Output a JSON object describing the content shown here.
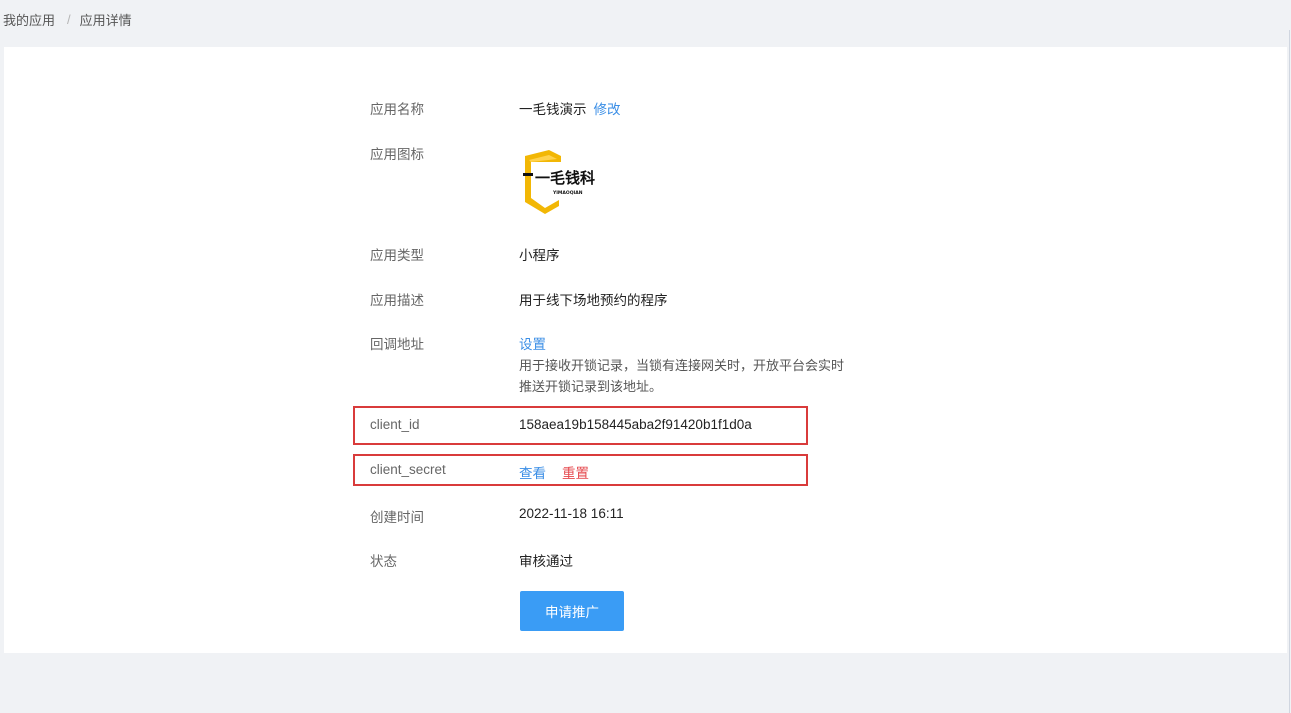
{
  "breadcrumb": {
    "items": [
      "我的应用",
      "应用详情"
    ],
    "separator": "/"
  },
  "details": {
    "app_name": {
      "label": "应用名称",
      "value": "一毛钱演示",
      "edit_label": "修改"
    },
    "app_icon": {
      "label": "应用图标",
      "logo_text": "一毛钱科技",
      "logo_subtext": "YIMAOQIAN"
    },
    "app_type": {
      "label": "应用类型",
      "value": "小程序"
    },
    "app_desc": {
      "label": "应用描述",
      "value": "用于线下场地预约的程序"
    },
    "callback": {
      "label": "回调地址",
      "action_label": "设置",
      "help_line1": "用于接收开锁记录，当锁有连接网关时，开放平台会实时",
      "help_line2": "推送开锁记录到该地址。"
    },
    "client_id": {
      "label": "client_id",
      "value": "158aea19b158445aba2f91420b1f1d0a"
    },
    "client_secret": {
      "label": "client_secret",
      "view_label": "查看",
      "reset_label": "重置"
    },
    "created": {
      "label": "创建时间",
      "value": "2022-11-18 16:11"
    },
    "status": {
      "label": "状态",
      "value": "审核通过"
    }
  },
  "actions": {
    "promote_label": "申请推广"
  },
  "colors": {
    "link": "#3a8ee6",
    "danger": "#e5484d",
    "primary_button": "#3a9cf5",
    "highlight_border": "#d93b3b",
    "logo_gold": "#f2b705"
  }
}
